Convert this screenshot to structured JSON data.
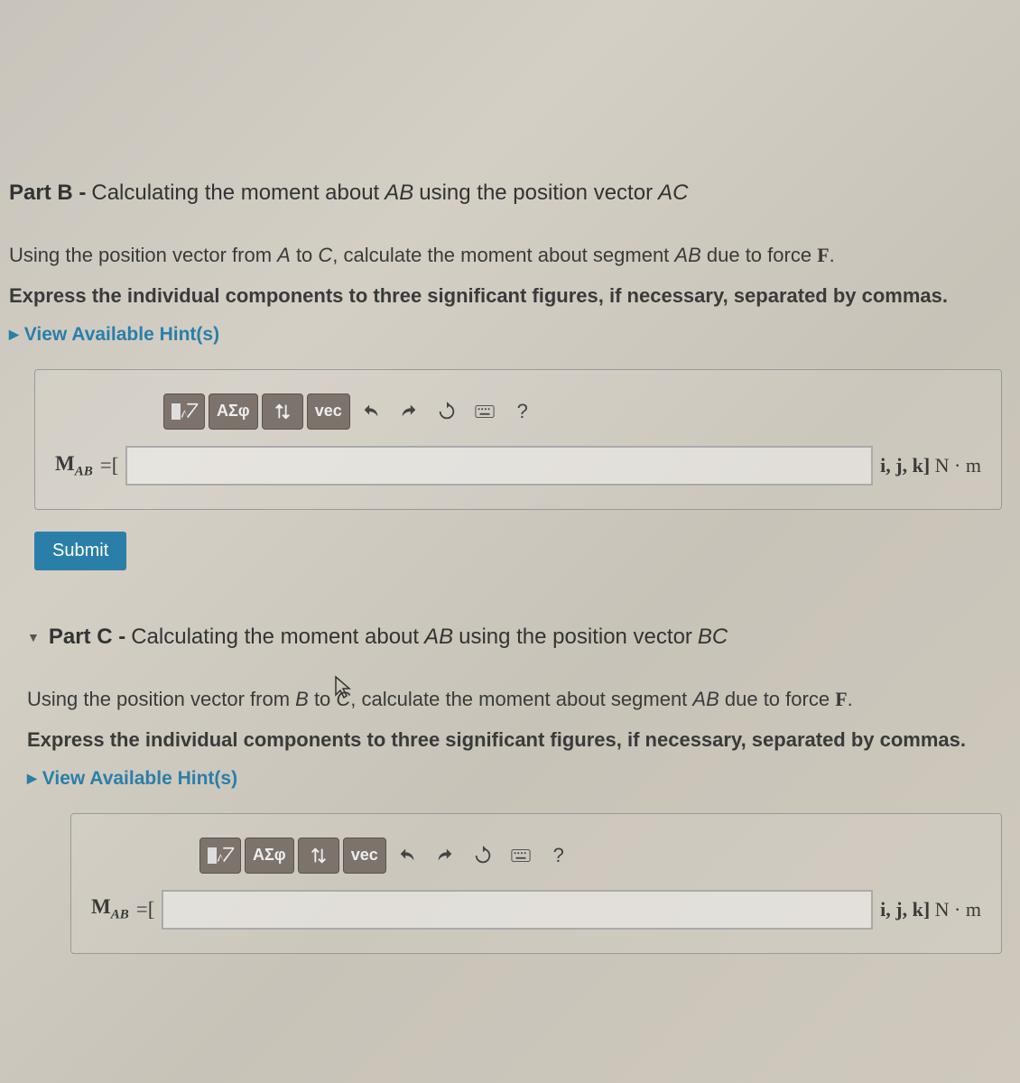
{
  "partB": {
    "label_prefix": "Part B -",
    "title_plain_1": " Calculating the moment about ",
    "title_italic_1": "AB",
    "title_plain_2": " using the position vector ",
    "title_italic_2": "AC",
    "desc_1": "Using the position vector from ",
    "desc_A": "A",
    "desc_2": " to ",
    "desc_C": "C",
    "desc_3": ", calculate the moment about segment ",
    "desc_AB": "AB",
    "desc_4": " due to force ",
    "desc_F": "F",
    "desc_end": ".",
    "instructions": "Express the individual components to three significant figures, if necessary, separated by commas.",
    "hints_label": "View Available Hint(s)",
    "lhs_M": "M",
    "lhs_sub": "AB",
    "eq": " =[",
    "units_prefix": "i, j, k]",
    "units_suffix": " N · m",
    "submit": "Submit"
  },
  "partC": {
    "label_prefix": "Part C -",
    "title_plain_1": " Calculating the moment about ",
    "title_italic_1": "AB",
    "title_plain_2": " using the position vector ",
    "title_italic_2": "BC",
    "desc_1": "Using the position vector from ",
    "desc_A": "B",
    "desc_2": " to ",
    "desc_C": "C",
    "desc_3": ", calculate the moment about segment ",
    "desc_AB": "AB",
    "desc_4": " due to force ",
    "desc_F": "F",
    "desc_end": ".",
    "instructions": "Express the individual components to three significant figures, if necessary, separated by commas.",
    "hints_label": "View Available Hint(s)",
    "lhs_M": "M",
    "lhs_sub": "AB",
    "eq": " =[",
    "units_prefix": "i, j, k]",
    "units_suffix": " N · m"
  },
  "toolbar": {
    "greek": "ΑΣφ",
    "vec": "vec",
    "help": "?"
  }
}
